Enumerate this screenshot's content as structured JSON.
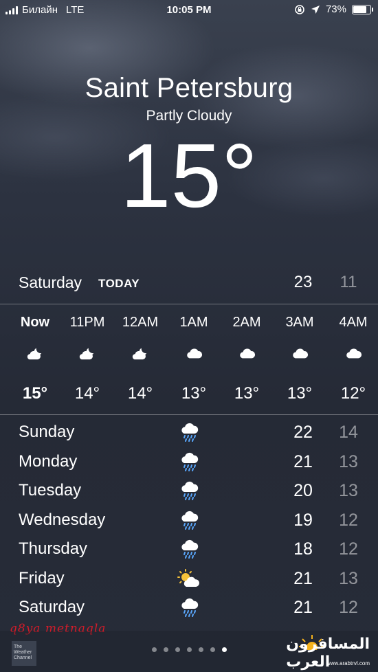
{
  "status_bar": {
    "carrier": "Билайн",
    "network": "LTE",
    "time": "10:05 PM",
    "battery": "73%",
    "battery_level": 0.73
  },
  "current": {
    "city": "Saint Petersburg",
    "condition": "Partly Cloudy",
    "temperature": "15°"
  },
  "today": {
    "day": "Saturday",
    "label": "TODAY",
    "high": "23",
    "low": "11"
  },
  "hourly": [
    {
      "time": "Now",
      "icon": "partly-cloudy-night-icon",
      "temp": "15°"
    },
    {
      "time": "11PM",
      "icon": "partly-cloudy-night-icon",
      "temp": "14°"
    },
    {
      "time": "12AM",
      "icon": "partly-cloudy-night-icon",
      "temp": "14°"
    },
    {
      "time": "1AM",
      "icon": "cloud-icon",
      "temp": "13°"
    },
    {
      "time": "2AM",
      "icon": "cloud-icon",
      "temp": "13°"
    },
    {
      "time": "3AM",
      "icon": "cloud-icon",
      "temp": "13°"
    },
    {
      "time": "4AM",
      "icon": "cloud-icon",
      "temp": "12°"
    }
  ],
  "daily": [
    {
      "day": "Sunday",
      "icon": "rain-icon",
      "high": "22",
      "low": "14"
    },
    {
      "day": "Monday",
      "icon": "rain-icon",
      "high": "21",
      "low": "13"
    },
    {
      "day": "Tuesday",
      "icon": "rain-icon",
      "high": "20",
      "low": "13"
    },
    {
      "day": "Wednesday",
      "icon": "rain-icon",
      "high": "19",
      "low": "12"
    },
    {
      "day": "Thursday",
      "icon": "rain-icon",
      "high": "18",
      "low": "12"
    },
    {
      "day": "Friday",
      "icon": "partly-sunny-icon",
      "high": "21",
      "low": "13"
    },
    {
      "day": "Saturday",
      "icon": "rain-icon",
      "high": "21",
      "low": "12"
    }
  ],
  "footer": {
    "twc_logo_text": "The Weather Channel",
    "page_count": 7,
    "active_page": 6,
    "watermark": "q8ya metnaqla",
    "site_logo": "المسافرون العرب",
    "site_url": "www.arabtrvl.com"
  },
  "colors": {
    "background": "#2c3240",
    "low_temp": "rgba(255,255,255,0.5)",
    "watermark": "#d41c2a"
  }
}
